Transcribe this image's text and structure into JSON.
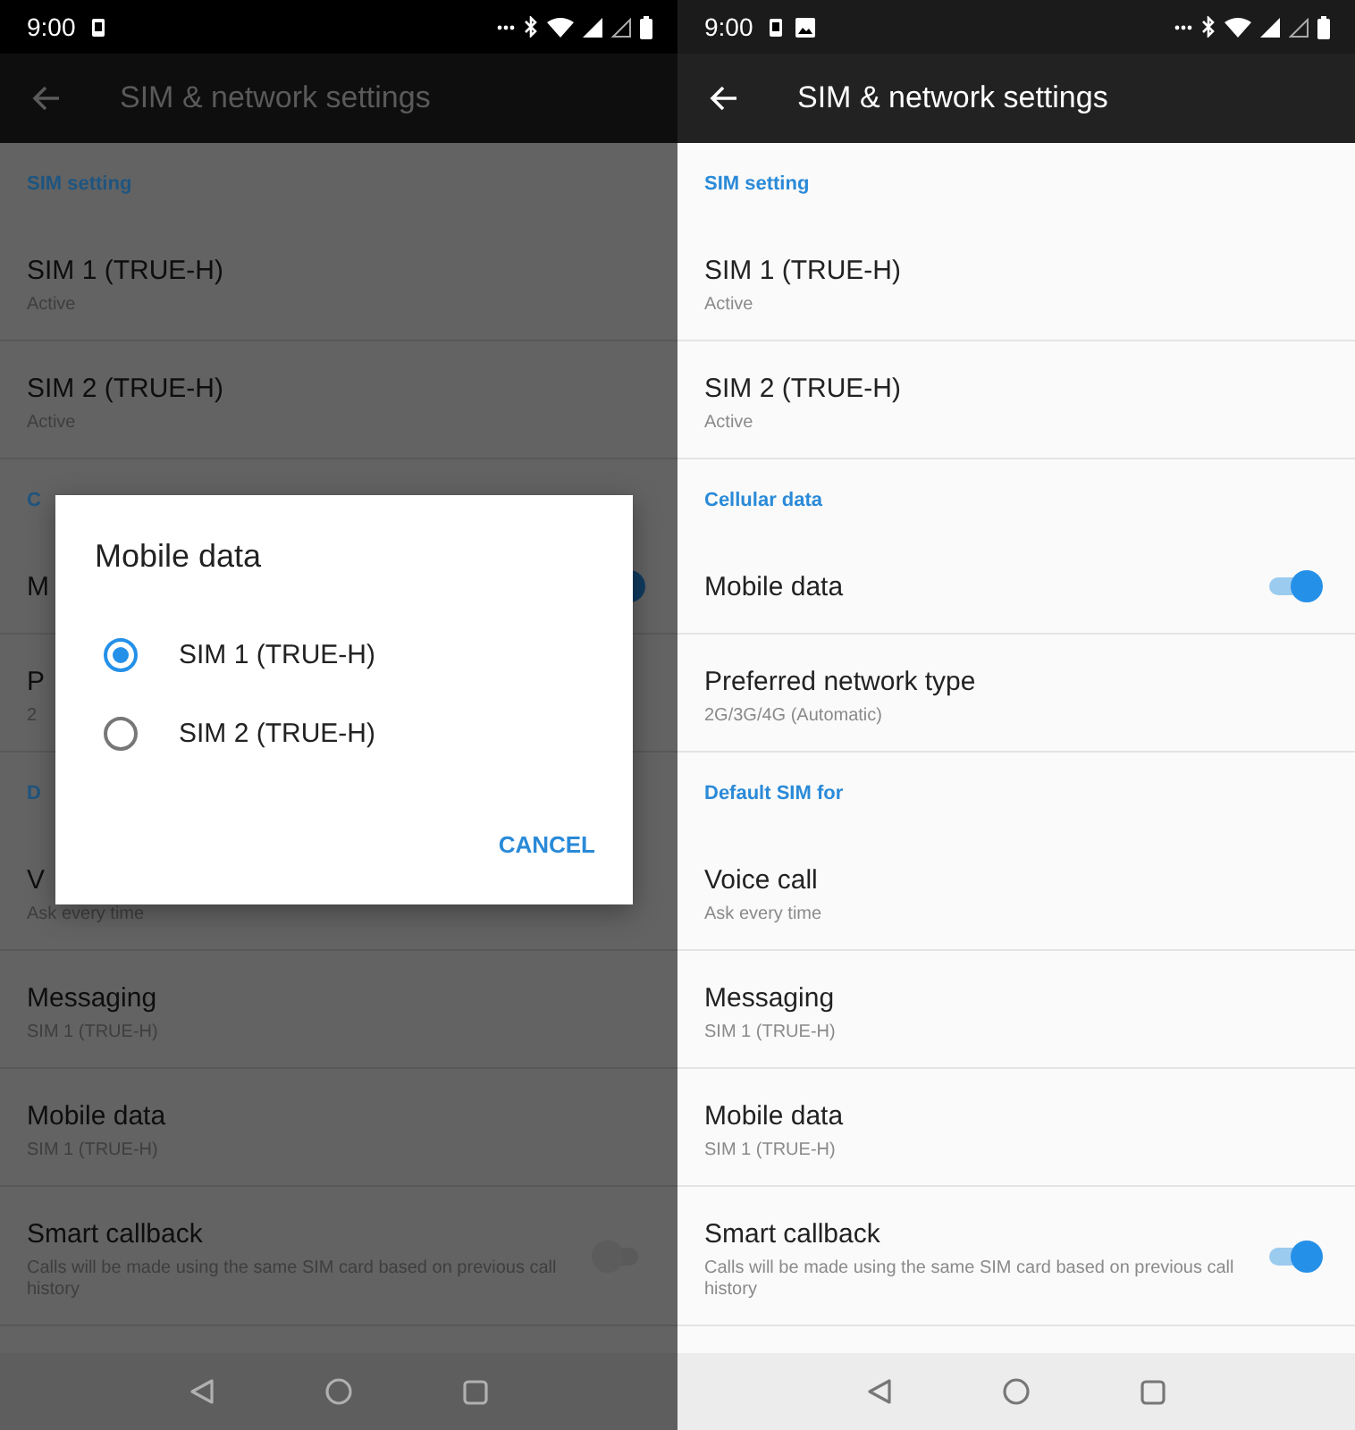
{
  "screens": [
    {
      "dimmed": true,
      "status_bar": {
        "time": "9:00",
        "notification_icons": [
          {
            "kind": "device"
          }
        ]
      },
      "app_bar": {
        "title": "SIM & network settings"
      },
      "sections": [
        {
          "header": "SIM setting",
          "items": [
            {
              "title": "SIM 1  (TRUE-H)",
              "subtitle": "Active"
            },
            {
              "title": "SIM 2  (TRUE-H)",
              "subtitle": "Active"
            }
          ]
        },
        {
          "header": "C",
          "items": [
            {
              "title": "M",
              "toggle": true
            },
            {
              "title": "P",
              "subtitle": "2"
            }
          ]
        },
        {
          "header": "D",
          "items": [
            {
              "title": "V",
              "subtitle": "Ask every time"
            },
            {
              "title": "Messaging",
              "subtitle": "SIM 1  (TRUE-H)"
            },
            {
              "title": "Mobile data",
              "subtitle": "SIM 1  (TRUE-H)"
            },
            {
              "title": "Smart callback",
              "subtitle": "Calls will be made using the same SIM card based on previous call history",
              "toggle": false
            }
          ]
        }
      ],
      "dialog": {
        "title": "Mobile data",
        "options": [
          {
            "label": "SIM 1  (TRUE-H)",
            "selected": true
          },
          {
            "label": "SIM 2  (TRUE-H)",
            "selected": false
          }
        ],
        "button": "CANCEL"
      }
    },
    {
      "dimmed": false,
      "status_bar": {
        "time": "9:00",
        "notification_icons": [
          {
            "kind": "device"
          },
          {
            "kind": "image"
          }
        ]
      },
      "app_bar": {
        "title": "SIM & network settings"
      },
      "sections": [
        {
          "header": "SIM setting",
          "items": [
            {
              "title": "SIM 1  (TRUE-H)",
              "subtitle": "Active"
            },
            {
              "title": "SIM 2  (TRUE-H)",
              "subtitle": "Active"
            }
          ]
        },
        {
          "header": "Cellular data",
          "items": [
            {
              "title": "Mobile data",
              "toggle": true
            },
            {
              "title": "Preferred network type",
              "subtitle": "2G/3G/4G (Automatic)"
            }
          ]
        },
        {
          "header": "Default SIM for",
          "items": [
            {
              "title": "Voice call",
              "subtitle": "Ask every time"
            },
            {
              "title": "Messaging",
              "subtitle": "SIM 1  (TRUE-H)"
            },
            {
              "title": "Mobile data",
              "subtitle": "SIM 1  (TRUE-H)"
            },
            {
              "title": "Smart callback",
              "subtitle": "Calls will be made using the same SIM card based on previous call history",
              "toggle": true
            }
          ]
        }
      ]
    }
  ]
}
